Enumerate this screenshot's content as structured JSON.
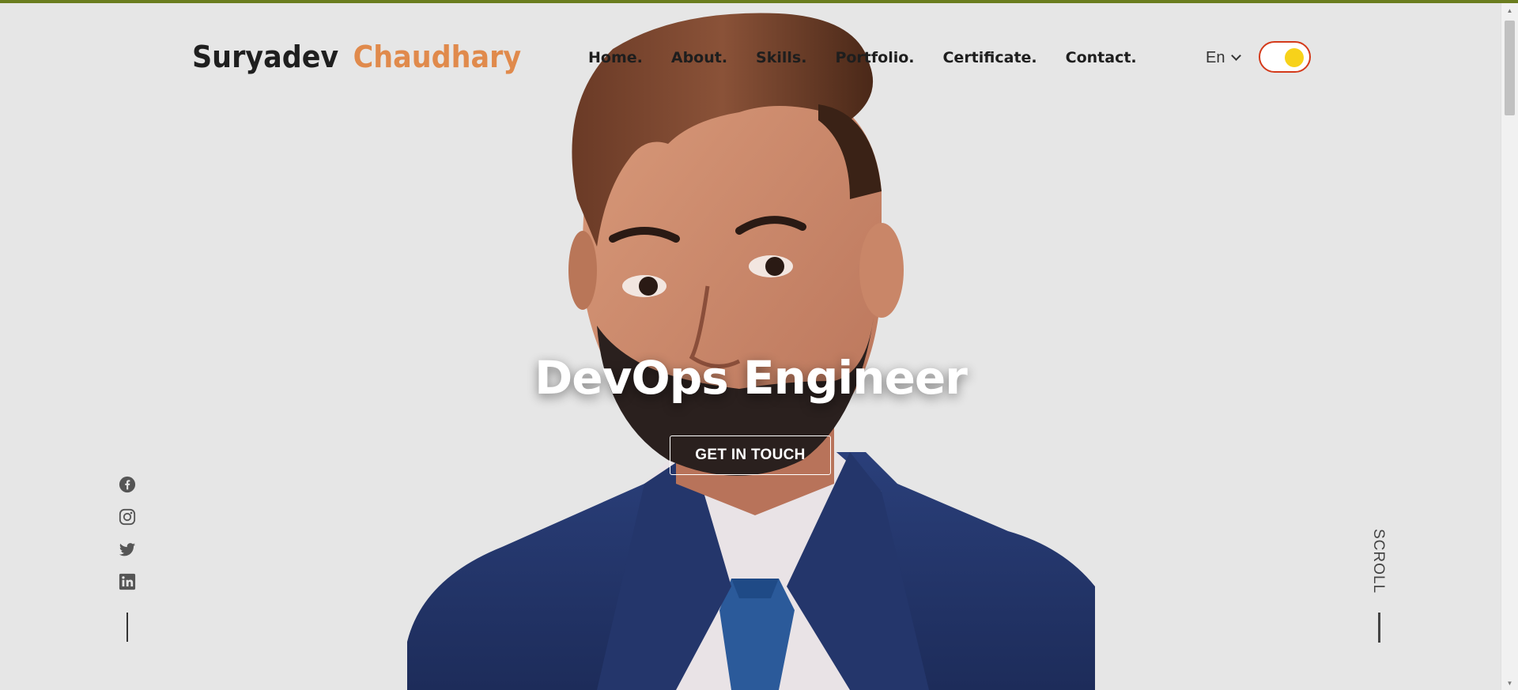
{
  "header": {
    "logo_first": "Suryadev",
    "logo_last": "Chaudhary",
    "nav": [
      "Home.",
      "About.",
      "Skills.",
      "Portfolio.",
      "Certificate.",
      "Contact."
    ],
    "language": "En",
    "theme_toggle": "dark-mode-toggle"
  },
  "hero": {
    "title": "DevOps Engineer",
    "cta_label": "GET IN TOUCH",
    "portrait": "profile-photo"
  },
  "social": [
    "facebook-icon",
    "instagram-icon",
    "twitter-icon",
    "linkedin-icon"
  ],
  "scroll_label": "SCROLL",
  "colors": {
    "background": "#e6e6e6",
    "accent": "#e08a4c",
    "toggle_border": "#d43a1a",
    "toggle_knob": "#f7d21a",
    "top_strip": "#6b7d1f"
  }
}
